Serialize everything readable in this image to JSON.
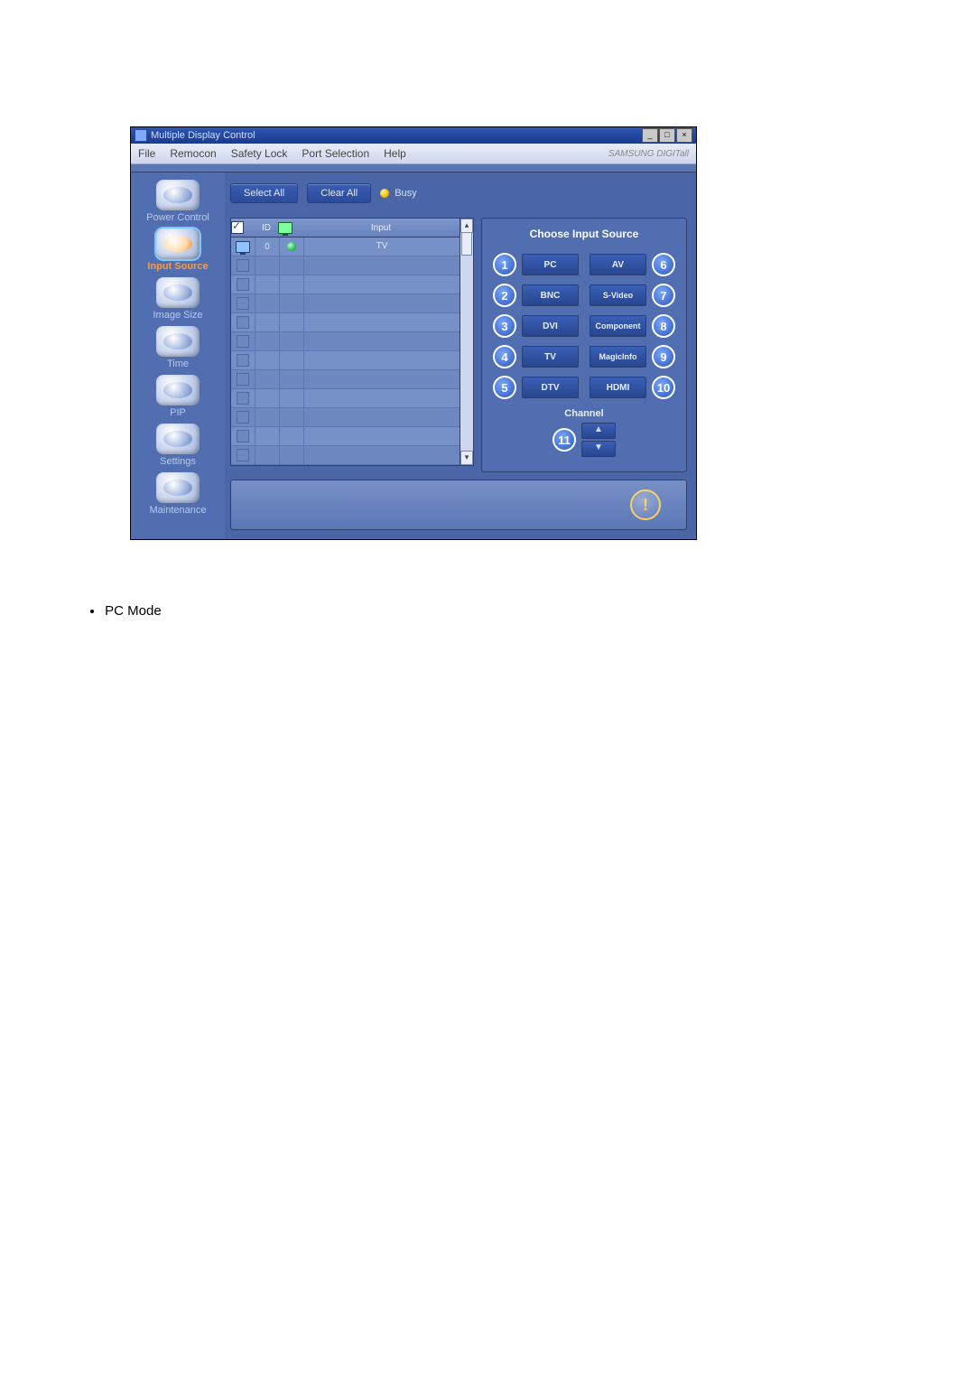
{
  "window": {
    "title": "Multiple Display Control",
    "brand": "SAMSUNG DIGITall"
  },
  "menu": {
    "file": "File",
    "remocon": "Remocon",
    "safety": "Safety Lock",
    "port": "Port Selection",
    "help": "Help"
  },
  "sidebar": [
    {
      "label": "Power Control",
      "active": false
    },
    {
      "label": "Input Source",
      "active": true
    },
    {
      "label": "Image Size",
      "active": false
    },
    {
      "label": "Time",
      "active": false
    },
    {
      "label": "PIP",
      "active": false
    },
    {
      "label": "Settings",
      "active": false
    },
    {
      "label": "Maintenance",
      "active": false
    }
  ],
  "toolbar": {
    "select_all": "Select All",
    "clear_all": "Clear All",
    "busy": "Busy"
  },
  "list": {
    "headers": {
      "c2": "ID",
      "c4": "Input"
    },
    "rows": [
      {
        "checked": true,
        "id": "0",
        "status": "green",
        "input": "TV"
      },
      {
        "checked": false,
        "id": "",
        "status": "",
        "input": ""
      },
      {
        "checked": false,
        "id": "",
        "status": "",
        "input": ""
      },
      {
        "checked": false,
        "id": "",
        "status": "",
        "input": ""
      },
      {
        "checked": false,
        "id": "",
        "status": "",
        "input": ""
      },
      {
        "checked": false,
        "id": "",
        "status": "",
        "input": ""
      },
      {
        "checked": false,
        "id": "",
        "status": "",
        "input": ""
      },
      {
        "checked": false,
        "id": "",
        "status": "",
        "input": ""
      },
      {
        "checked": false,
        "id": "",
        "status": "",
        "input": ""
      },
      {
        "checked": false,
        "id": "",
        "status": "",
        "input": ""
      },
      {
        "checked": false,
        "id": "",
        "status": "",
        "input": ""
      },
      {
        "checked": false,
        "id": "",
        "status": "",
        "input": ""
      }
    ]
  },
  "panel": {
    "title": "Choose Input Source",
    "sources_left": [
      {
        "n": "1",
        "label": "PC"
      },
      {
        "n": "2",
        "label": "BNC"
      },
      {
        "n": "3",
        "label": "DVI"
      },
      {
        "n": "4",
        "label": "TV"
      },
      {
        "n": "5",
        "label": "DTV"
      }
    ],
    "sources_right": [
      {
        "n": "6",
        "label": "AV"
      },
      {
        "n": "7",
        "label": "S-Video"
      },
      {
        "n": "8",
        "label": "Component"
      },
      {
        "n": "9",
        "label": "MagicInfo"
      },
      {
        "n": "10",
        "label": "HDMI"
      }
    ],
    "channel_label": "Channel",
    "channel_n": "11",
    "ch_up": "▲",
    "ch_down": "▼"
  },
  "caption": "PC Mode"
}
